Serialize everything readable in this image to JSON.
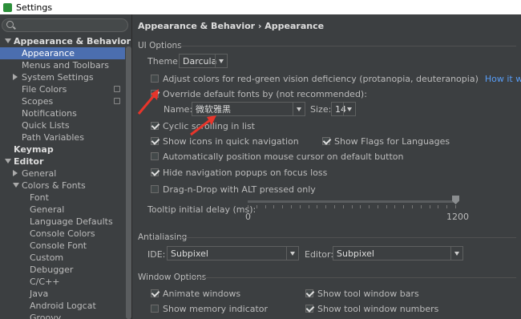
{
  "window": {
    "title": "Settings"
  },
  "sidebar": {
    "search_placeholder": "",
    "items": [
      {
        "label": "Appearance & Behavior",
        "level": 0,
        "bold": true,
        "expanded": true
      },
      {
        "label": "Appearance",
        "level": 1,
        "selected": true
      },
      {
        "label": "Menus and Toolbars",
        "level": 1
      },
      {
        "label": "System Settings",
        "level": 1,
        "collapsed": true
      },
      {
        "label": "File Colors",
        "level": 1,
        "project_icon": true
      },
      {
        "label": "Scopes",
        "level": 1,
        "project_icon": true
      },
      {
        "label": "Notifications",
        "level": 1
      },
      {
        "label": "Quick Lists",
        "level": 1
      },
      {
        "label": "Path Variables",
        "level": 1
      },
      {
        "label": "Keymap",
        "level": 0,
        "bold": true
      },
      {
        "label": "Editor",
        "level": 0,
        "bold": true,
        "expanded": true
      },
      {
        "label": "General",
        "level": 1,
        "collapsed": true
      },
      {
        "label": "Colors & Fonts",
        "level": 1,
        "expanded": true
      },
      {
        "label": "Font",
        "level": 2
      },
      {
        "label": "General",
        "level": 2
      },
      {
        "label": "Language Defaults",
        "level": 2
      },
      {
        "label": "Console Colors",
        "level": 2
      },
      {
        "label": "Console Font",
        "level": 2
      },
      {
        "label": "Custom",
        "level": 2
      },
      {
        "label": "Debugger",
        "level": 2
      },
      {
        "label": "C/C++",
        "level": 2
      },
      {
        "label": "Java",
        "level": 2
      },
      {
        "label": "Android Logcat",
        "level": 2
      },
      {
        "label": "Groovy",
        "level": 2
      }
    ]
  },
  "main": {
    "breadcrumb": "Appearance & Behavior › Appearance",
    "ui_options": {
      "title": "UI Options",
      "theme_label": "Theme:",
      "theme_value": "Darcula",
      "adjust_colors": {
        "label": "Adjust colors for red-green vision deficiency (protanopia, deuteranopia)",
        "checked": false
      },
      "how_it_works": "How it works",
      "override_fonts": {
        "label": "Override default fonts by (not recommended):",
        "checked": true
      },
      "name_label": "Name:",
      "name_value": "微软雅黑",
      "size_label": "Size:",
      "size_value": "14",
      "cyclic_scrolling": {
        "label": "Cyclic scrolling in list",
        "checked": true
      },
      "show_icons": {
        "label": "Show icons in quick navigation",
        "checked": true
      },
      "show_flags": {
        "label": "Show Flags for Languages",
        "checked": true
      },
      "auto_position": {
        "label": "Automatically position mouse cursor on default button",
        "checked": false
      },
      "hide_navigation": {
        "label": "Hide navigation popups on focus loss",
        "checked": true
      },
      "drag_n_drop": {
        "label": "Drag-n-Drop with ALT pressed only",
        "checked": false
      },
      "tooltip_label": "Tooltip initial delay (ms):",
      "tooltip_min": "0",
      "tooltip_max": "1200",
      "tooltip_value": 1200
    },
    "antialiasing": {
      "title": "Antialiasing",
      "ide_label": "IDE:",
      "ide_value": "Subpixel",
      "editor_label": "Editor:",
      "editor_value": "Subpixel"
    },
    "window_options": {
      "title": "Window Options",
      "animate_windows": {
        "label": "Animate windows",
        "checked": true
      },
      "show_memory": {
        "label": "Show memory indicator",
        "checked": false
      },
      "show_tool_bars": {
        "label": "Show tool window bars",
        "checked": true
      },
      "show_tool_numbers": {
        "label": "Show tool window numbers",
        "checked": true
      }
    }
  },
  "colors": {
    "background": "#3C3F41",
    "selection": "#4B6EAF",
    "link": "#589DF6",
    "annotation_arrow": "#E8352B"
  }
}
